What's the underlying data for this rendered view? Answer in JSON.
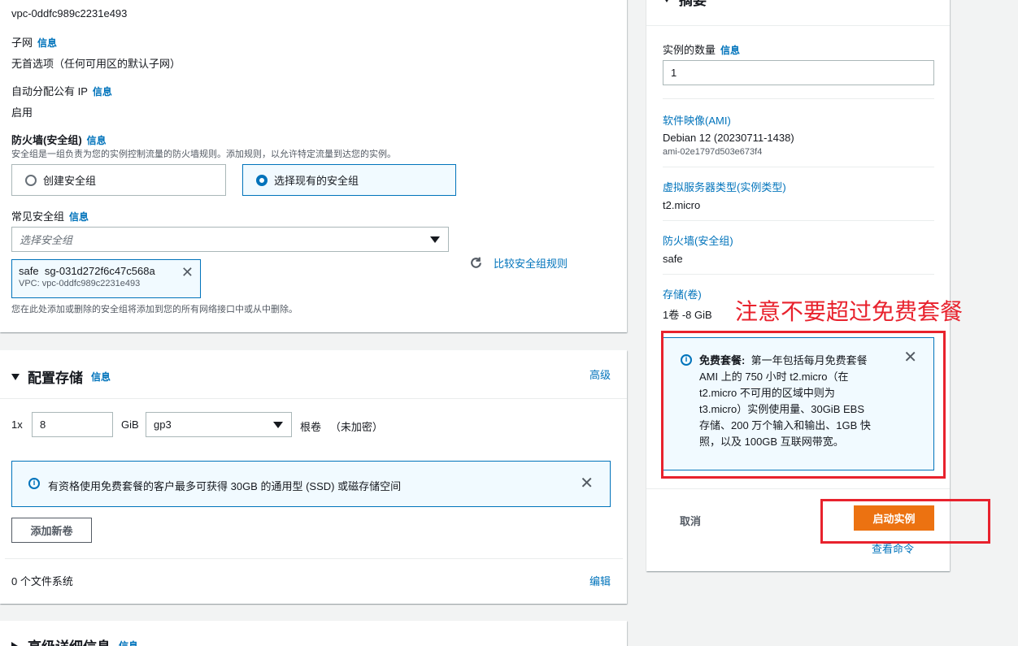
{
  "network": {
    "vpc_value": "vpc-0ddfc989c2231e493",
    "subnet_label": "子网",
    "subnet_value": "无首选项（任何可用区的默认子网）",
    "auto_ip_label": "自动分配公有 IP",
    "auto_ip_value": "启用",
    "firewall_label": "防火墙(安全组)",
    "firewall_desc": "安全组是一组负责为您的实例控制流量的防火墙规则。添加规则，以允许特定流量到达您的实例。",
    "create_sg": "创建安全组",
    "select_existing_sg": "选择现有的安全组",
    "common_sg_label": "常见安全组",
    "sg_placeholder": "选择安全组",
    "token_name": "safe",
    "token_id": "sg-031d272f6c47c568a",
    "token_vpc": "VPC: vpc-0ddfc989c2231e493",
    "compare_rules": "比较安全组规则",
    "sg_footer": "您在此处添加或删除的安全组将添加到您的所有网络接口中或从中删除。"
  },
  "info_label": "信息",
  "storage": {
    "title": "配置存储",
    "advanced": "高级",
    "count_prefix": "1x",
    "size": "8",
    "unit": "GiB",
    "volume_type": "gp3",
    "root_label": "根卷",
    "encryption": "（未加密）",
    "alert_text": "有资格使用免费套餐的客户最多可获得 30GB 的通用型 (SSD) 或磁存储空间",
    "add_volume": "添加新卷",
    "filesystems": "0 个文件系统",
    "edit": "编辑"
  },
  "advanced_details": {
    "title": "高级详细信息"
  },
  "summary": {
    "title": "摘要",
    "instance_count_label": "实例的数量",
    "instance_count_value": "1",
    "ami_label": "软件映像(AMI)",
    "ami_value": "Debian 12 (20230711-1438)",
    "ami_id": "ami-02e1797d503e673f4",
    "instance_type_label": "虚拟服务器类型(实例类型)",
    "instance_type_value": "t2.micro",
    "firewall_label": "防火墙(安全组)",
    "firewall_value": "safe",
    "storage_label": "存储(卷)",
    "storage_value": "1卷 -8 GiB",
    "free_tier_title": "免费套餐:",
    "free_tier_lines": [
      "第一年包括每月免费套餐",
      "AMI 上的 750 小时 t2.micro（在",
      "t2.micro 不可用的区域中则为",
      "t3.micro）实例使用量、30GiB EBS",
      "存储、200 万个输入和输出、1GB 快",
      "照，以及 100GB 互联网带宽。"
    ],
    "cancel": "取消",
    "launch": "启动实例",
    "view_commands": "查看命令"
  },
  "annotation": {
    "text": "注意不要超过免费套餐",
    "color": "#e8222d"
  },
  "colors": {
    "accent": "#0073bb",
    "primary_button": "#ec7211"
  }
}
